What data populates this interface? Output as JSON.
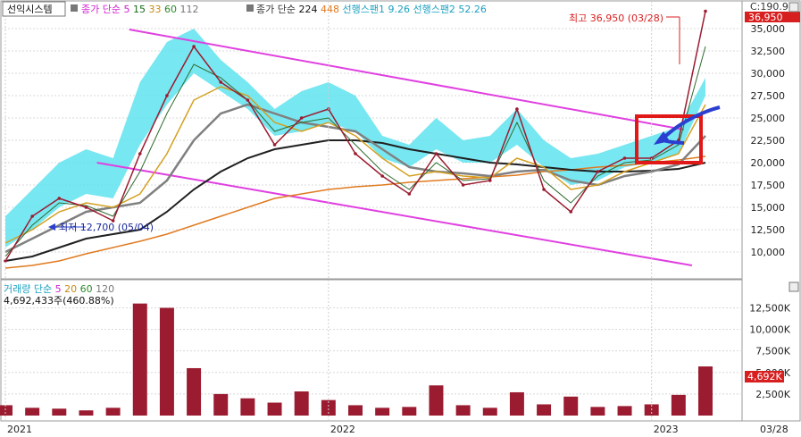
{
  "header": {
    "stock_name": "선익시스템",
    "ma_label": "종가 단순",
    "ma_periods": [
      "5",
      "15",
      "33",
      "60",
      "112"
    ],
    "ma_long_label": "종가 단순",
    "ma_long_periods": [
      "224",
      "448"
    ],
    "span1": "선행스팬1 9.26",
    "span2": "선행스팬2 52.26",
    "last_close_text": "C:190.94"
  },
  "volume_header": {
    "label": "거래량 단순",
    "ma_periods": [
      "5",
      "20",
      "60",
      "120"
    ],
    "last_volume": "4,692,433주(460.88%)"
  },
  "annotations": {
    "high_text": "최고 36,950 (03/28)",
    "low_text": "최저 12,700 (05/04)",
    "current_price_badge": "36,950",
    "current_volume_badge": "4,692K"
  },
  "colors": {
    "price": "#9b1b30",
    "cloud": "#5fe3ef",
    "channel": "#e040e0",
    "highlight_box": "#e01818",
    "arrow": "#2a3fd0",
    "ma5": "#2f6b2f",
    "ma33": "#d4a020",
    "ma60": "#808080",
    "ma112": "#202020",
    "ma448": "#e07a20",
    "volume_bar": "#9b1b30"
  },
  "chart_data": [
    {
      "type": "line",
      "title": "",
      "x_ticks": [
        "2021",
        "2022",
        "2023"
      ],
      "ylim": [
        8000,
        37000
      ],
      "y_ticks": [
        10000,
        12500,
        15000,
        17500,
        20000,
        22500,
        25000,
        27500,
        30000,
        32500,
        35000
      ],
      "y_tick_labels": [
        "10,000",
        "12,500",
        "15,000",
        "17,500",
        "20,000",
        "22,500",
        "25,000",
        "27,500",
        "30,000",
        "32,500",
        "35,000"
      ],
      "x": [
        "2021-01",
        "2021-02",
        "2021-03",
        "2021-04",
        "2021-05",
        "2021-06",
        "2021-07",
        "2021-08",
        "2021-09",
        "2021-10",
        "2021-11",
        "2021-12",
        "2022-01",
        "2022-02",
        "2022-03",
        "2022-04",
        "2022-05",
        "2022-06",
        "2022-07",
        "2022-08",
        "2022-09",
        "2022-10",
        "2022-11",
        "2022-12",
        "2023-01",
        "2023-02",
        "2023-03"
      ],
      "series": [
        {
          "name": "close",
          "values": [
            9000,
            14000,
            16000,
            15000,
            13500,
            21000,
            27500,
            33000,
            29000,
            27000,
            22000,
            25000,
            26000,
            21000,
            18500,
            16500,
            21000,
            17500,
            18000,
            26000,
            17000,
            14500,
            19000,
            20500,
            20500,
            22500,
            36950
          ]
        },
        {
          "name": "ma5",
          "values": [
            9500,
            13000,
            15500,
            15200,
            14000,
            19000,
            25500,
            31000,
            29500,
            27000,
            23500,
            24500,
            25000,
            22000,
            19000,
            17000,
            20000,
            18000,
            18200,
            24500,
            18000,
            15500,
            18500,
            20000,
            20300,
            22000,
            33000
          ]
        },
        {
          "name": "ma33",
          "values": [
            11000,
            12500,
            14500,
            15500,
            15000,
            16500,
            21000,
            27000,
            28500,
            27500,
            24500,
            23500,
            24500,
            23000,
            20500,
            18500,
            19000,
            18500,
            18300,
            20500,
            19500,
            17000,
            17500,
            19000,
            20000,
            21000,
            26500
          ]
        },
        {
          "name": "ma60",
          "values": [
            10000,
            11500,
            13000,
            14500,
            15000,
            15500,
            18000,
            22500,
            25500,
            26500,
            25500,
            24500,
            24000,
            23500,
            21500,
            19500,
            19000,
            18800,
            18500,
            19000,
            19200,
            18000,
            17500,
            18500,
            19000,
            19800,
            23000
          ]
        },
        {
          "name": "ma112",
          "values": [
            9000,
            9500,
            10500,
            11500,
            12000,
            12500,
            14500,
            17000,
            19000,
            20500,
            21500,
            22000,
            22500,
            22500,
            22200,
            21500,
            21000,
            20500,
            20000,
            19800,
            19500,
            19200,
            19000,
            19000,
            19100,
            19300,
            20000
          ]
        },
        {
          "name": "ma448",
          "values": [
            8200,
            8500,
            9000,
            9800,
            10500,
            11200,
            12000,
            13000,
            14000,
            15000,
            16000,
            16500,
            17000,
            17300,
            17500,
            17800,
            18000,
            18200,
            18400,
            18600,
            19000,
            19200,
            19500,
            19700,
            20000,
            20300,
            20700
          ]
        },
        {
          "name": "cloud_upper",
          "values": [
            14000,
            17000,
            20000,
            21500,
            20500,
            29000,
            33500,
            35000,
            31500,
            29000,
            26000,
            28000,
            29000,
            27500,
            23000,
            22000,
            25000,
            22500,
            23000,
            26000,
            22500,
            20500,
            21000,
            22000,
            23000,
            24000,
            29500
          ]
        },
        {
          "name": "cloud_lower",
          "values": [
            10500,
            12500,
            15000,
            16500,
            16000,
            22000,
            26500,
            30000,
            28000,
            26000,
            23000,
            23500,
            24500,
            23500,
            20500,
            19500,
            21500,
            20000,
            20000,
            22000,
            19500,
            17500,
            18000,
            19500,
            20000,
            21000,
            27500
          ]
        }
      ]
    },
    {
      "type": "bar",
      "title": "",
      "ylim": [
        0,
        14000
      ],
      "y_ticks": [
        2500,
        5000,
        7500,
        10000,
        12500
      ],
      "y_tick_labels": [
        "2,500K",
        "5,000K",
        "7,500K",
        "10,000K",
        "12,500K"
      ],
      "x": [
        "2021-01",
        "2021-02",
        "2021-03",
        "2021-04",
        "2021-05",
        "2021-06",
        "2021-07",
        "2021-08",
        "2021-09",
        "2021-10",
        "2021-11",
        "2021-12",
        "2022-01",
        "2022-02",
        "2022-03",
        "2022-04",
        "2022-05",
        "2022-06",
        "2022-07",
        "2022-08",
        "2022-09",
        "2022-10",
        "2022-11",
        "2022-12",
        "2023-01",
        "2023-02",
        "2023-03"
      ],
      "series": [
        {
          "name": "volume",
          "values": [
            1200,
            900,
            800,
            600,
            900,
            13000,
            12500,
            5500,
            2500,
            2000,
            1500,
            2800,
            1800,
            1200,
            900,
            1000,
            3500,
            1200,
            900,
            2700,
            1300,
            2200,
            1000,
            1100,
            1300,
            2400,
            5700
          ]
        }
      ]
    }
  ],
  "x_axis": {
    "end_label": "03/28"
  }
}
